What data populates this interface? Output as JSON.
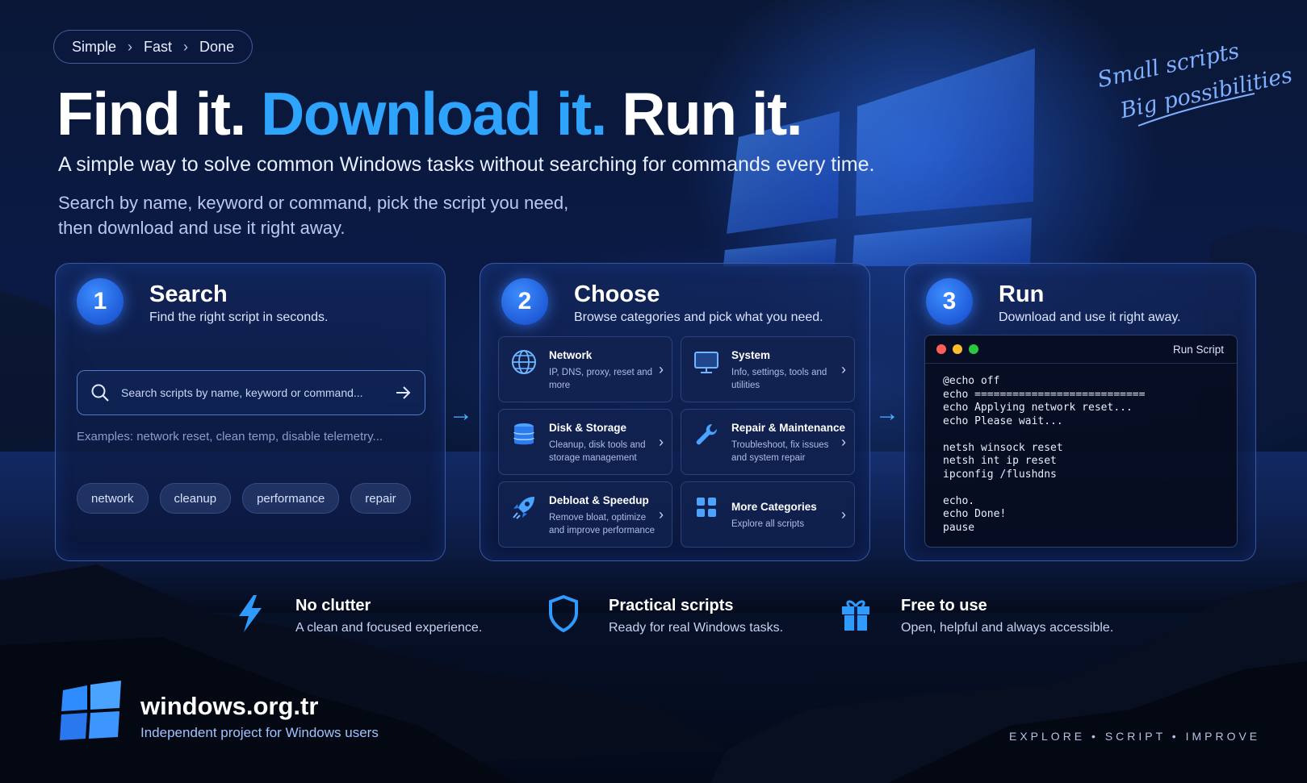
{
  "breadcrumb": {
    "items": [
      "Simple",
      "Fast",
      "Done"
    ]
  },
  "tagline": {
    "line1": "Small scripts",
    "line2": "Big possibilities"
  },
  "headline": {
    "part1": "Find it.",
    "part2": "Download it.",
    "part3": "Run it."
  },
  "subtitle": "A simple way to solve common Windows tasks without searching for commands every time.",
  "description": {
    "line1": "Search by name, keyword or command, pick the script you need,",
    "line2": "then download and use it right away."
  },
  "cards": {
    "search": {
      "number": "1",
      "title": "Search",
      "desc": "Find the right script in seconds.",
      "placeholder": "Search scripts by name, keyword or command...",
      "examples": "Examples: network reset, clean temp, disable telemetry...",
      "chips": [
        "network",
        "cleanup",
        "performance",
        "repair"
      ]
    },
    "choose": {
      "number": "2",
      "title": "Choose",
      "desc": "Browse categories and pick what you need.",
      "categories": [
        {
          "name": "Network",
          "desc": "IP, DNS, proxy, reset and more",
          "icon": "globe-icon"
        },
        {
          "name": "System",
          "desc": "Info, settings, tools and utilities",
          "icon": "monitor-icon"
        },
        {
          "name": "Disk & Storage",
          "desc": "Cleanup, disk tools and storage management",
          "icon": "database-icon"
        },
        {
          "name": "Repair & Maintenance",
          "desc": "Troubleshoot, fix issues and system repair",
          "icon": "wrench-icon"
        },
        {
          "name": "Debloat & Speedup",
          "desc": "Remove bloat, optimize and improve performance",
          "icon": "rocket-icon"
        },
        {
          "name": "More Categories",
          "desc": "Explore all scripts",
          "icon": "grid-icon"
        }
      ]
    },
    "run": {
      "number": "3",
      "title": "Run",
      "desc": "Download and use it right away.",
      "terminal_title": "Run Script",
      "code": "@echo off\necho ===========================\necho Applying network reset...\necho Please wait...\n\nnetsh winsock reset\nnetsh int ip reset\nipconfig /flushdns\n\necho.\necho Done!\npause"
    }
  },
  "features": [
    {
      "title": "No clutter",
      "desc": "A clean and focused experience.",
      "icon": "lightning-icon"
    },
    {
      "title": "Practical scripts",
      "desc": "Ready for real Windows tasks.",
      "icon": "shield-icon"
    },
    {
      "title": "Free to use",
      "desc": "Open, helpful and always accessible.",
      "icon": "gift-icon"
    }
  ],
  "brand": {
    "name": "windows.org.tr",
    "sub": "Independent project for Windows users"
  },
  "footer": "EXPLORE  •  SCRIPT  •  IMPROVE",
  "colors": {
    "accent": "#2fa4ff",
    "background": "#0a1736",
    "card_border": "#5f8ceb"
  }
}
